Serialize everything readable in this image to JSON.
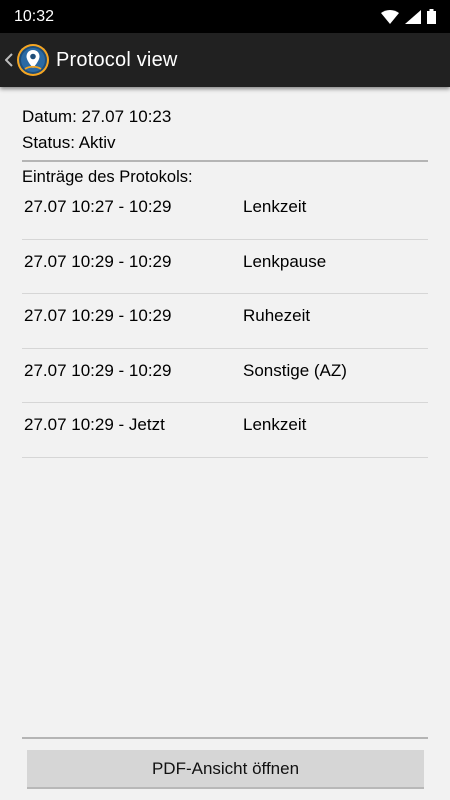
{
  "status_bar": {
    "time": "10:32",
    "icons": [
      "wifi-icon",
      "signal-icon",
      "battery-icon"
    ]
  },
  "app_bar": {
    "title": "Protocol view",
    "back_icon": "chevron-left-icon",
    "logo_icon": "location-pin-logo-icon"
  },
  "protocol": {
    "datum": "Datum: 27.07 10:23",
    "status": "Status: Aktiv",
    "entries_header": "Einträge des Protokols:",
    "entries": [
      {
        "time": "27.07 10:27 - 10:29",
        "type": "Lenkzeit"
      },
      {
        "time": "27.07 10:29 - 10:29",
        "type": "Lenkpause"
      },
      {
        "time": "27.07 10:29 - 10:29",
        "type": "Ruhezeit"
      },
      {
        "time": "27.07 10:29 - 10:29",
        "type": "Sonstige (AZ)"
      },
      {
        "time": "27.07 10:29 - Jetzt",
        "type": "Lenkzeit"
      }
    ]
  },
  "footer": {
    "pdf_button_label": "PDF-Ansicht öffnen"
  },
  "colors": {
    "status_bar_bg": "#000000",
    "app_bar_bg": "#212121",
    "page_bg": "#f2f2f2",
    "button_bg": "#d6d6d6",
    "logo_ring": "#f5a623",
    "logo_bg": "#1f4e79"
  }
}
